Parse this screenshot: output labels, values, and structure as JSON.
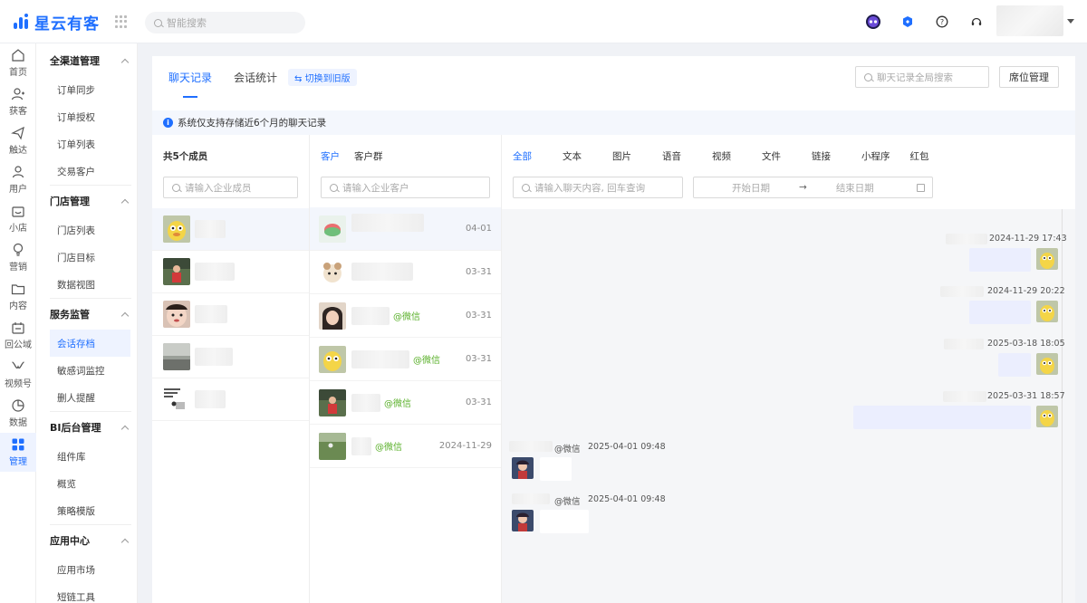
{
  "app": {
    "logo_text": "星云有客"
  },
  "topbar": {
    "search_placeholder": "智能搜索"
  },
  "rail": [
    {
      "label": "首页",
      "icon": "home-icon"
    },
    {
      "label": "获客",
      "icon": "user-add-icon"
    },
    {
      "label": "触达",
      "icon": "send-icon"
    },
    {
      "label": "用户",
      "icon": "user-icon"
    },
    {
      "label": "小店",
      "icon": "shop-icon"
    },
    {
      "label": "营销",
      "icon": "bulb-icon"
    },
    {
      "label": "内容",
      "icon": "folder-icon"
    },
    {
      "label": "回公域",
      "icon": "return-icon"
    },
    {
      "label": "视频号",
      "icon": "video-icon"
    },
    {
      "label": "数据",
      "icon": "pie-icon"
    },
    {
      "label": "管理",
      "icon": "grid-icon"
    }
  ],
  "menu": {
    "groups": [
      {
        "title": "全渠道管理",
        "items": [
          "订单同步",
          "订单授权",
          "订单列表",
          "交易客户"
        ]
      },
      {
        "title": "门店管理",
        "items": [
          "门店列表",
          "门店目标",
          "数据视图"
        ]
      },
      {
        "title": "服务监管",
        "items": [
          "会话存档",
          "敏感词监控",
          "删人提醒"
        ]
      },
      {
        "title": "BI后台管理",
        "items": [
          "组件库",
          "概览",
          "策略模版"
        ]
      },
      {
        "title": "应用中心",
        "items": [
          "应用市场",
          "短链工具"
        ]
      }
    ]
  },
  "main": {
    "tabs": [
      "聊天记录",
      "会话统计"
    ],
    "switch_label": "⇆ 切换到旧版",
    "global_search_placeholder": "聊天记录全局搜索",
    "seat_button": "席位管理",
    "notice": "系统仅支持存储近6个月的聊天记录"
  },
  "members": {
    "title": "共5个成员",
    "search_placeholder": "请输入企业成员"
  },
  "customers": {
    "tabs": [
      "客户",
      "客户群"
    ],
    "search_placeholder": "请输入企业客户",
    "rows": [
      {
        "tag": "",
        "date": "04-01"
      },
      {
        "tag": "",
        "date": "03-31"
      },
      {
        "tag": "@微信",
        "date": "03-31"
      },
      {
        "tag": "@微信",
        "date": "03-31"
      },
      {
        "tag": "@微信",
        "date": "03-31"
      },
      {
        "tag": "@微信",
        "date": "2024-11-29"
      }
    ]
  },
  "chat": {
    "filters": [
      "全部",
      "文本",
      "图片",
      "语音",
      "视频",
      "文件",
      "链接",
      "小程序",
      "红包"
    ],
    "search_placeholder": "请输入聊天内容, 回车查询",
    "start_date": "开始日期",
    "end_date": "结束日期",
    "date_sep": "→",
    "messages_right": [
      "2024-11-29 17:43",
      "2024-11-29 20:22",
      "2025-03-18 18:05",
      "2025-03-31 18:57"
    ],
    "messages_left": [
      {
        "tag": "@微信",
        "time": "2025-04-01 09:48"
      },
      {
        "tag": "@微信",
        "time": "2025-04-01 09:48"
      }
    ]
  }
}
